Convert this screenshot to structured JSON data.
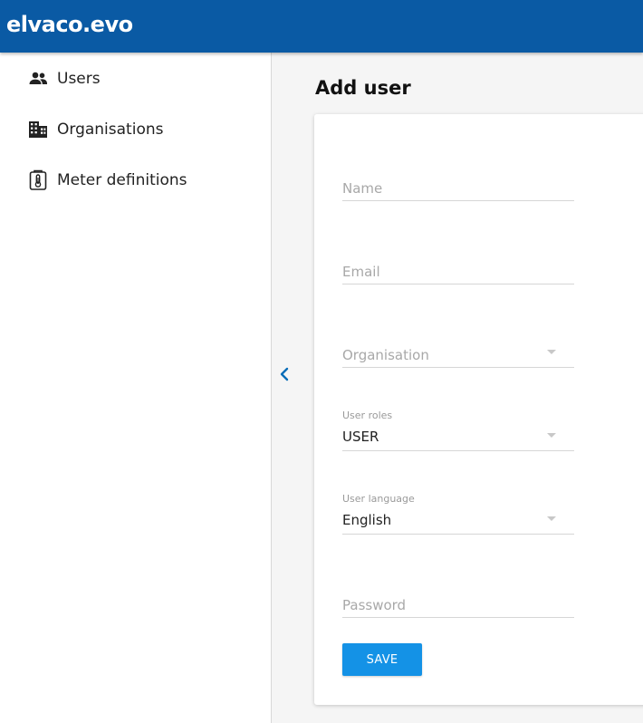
{
  "app": {
    "brand": "elvaco.evo"
  },
  "sidebar": {
    "items": [
      {
        "label": "Users",
        "icon": "users-icon"
      },
      {
        "label": "Organisations",
        "icon": "building-icon"
      },
      {
        "label": "Meter definitions",
        "icon": "meter-definition-icon"
      }
    ]
  },
  "page": {
    "title": "Add user"
  },
  "form": {
    "name": {
      "placeholder": "Name",
      "value": ""
    },
    "email": {
      "placeholder": "Email",
      "value": ""
    },
    "organisation": {
      "placeholder": "Organisation",
      "value": ""
    },
    "user_roles": {
      "label": "User roles",
      "value": "USER"
    },
    "user_language": {
      "label": "User language",
      "value": "English"
    },
    "password": {
      "placeholder": "Password",
      "value": ""
    },
    "save_label": "SAVE"
  },
  "colors": {
    "header": "#0a5aa4",
    "accent": "#1492e6",
    "collapse_icon": "#0a6db8"
  }
}
